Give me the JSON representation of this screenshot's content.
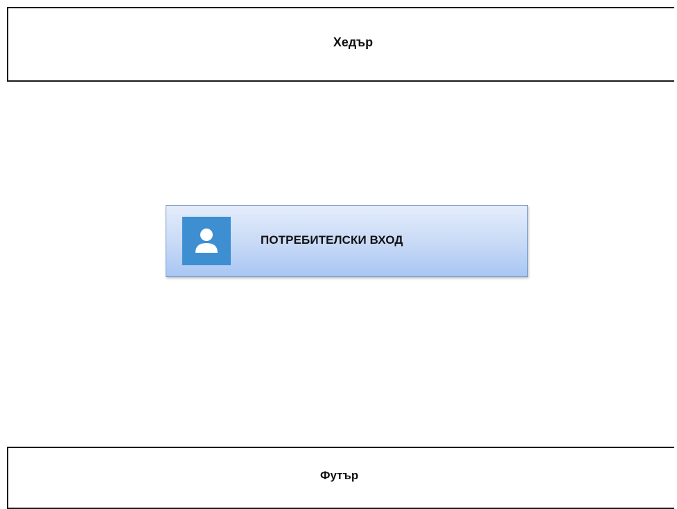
{
  "header": {
    "label": "Хедър"
  },
  "login_button": {
    "label": "ПОТРЕБИТЕЛСКИ ВХОД",
    "icon": "user-icon"
  },
  "footer": {
    "label": "Футър"
  },
  "colors": {
    "icon_background": "#3d8fd1",
    "button_gradient_top": "#e4edfb",
    "button_gradient_bottom": "#a8c6f4",
    "border": "#1a1a1a"
  }
}
